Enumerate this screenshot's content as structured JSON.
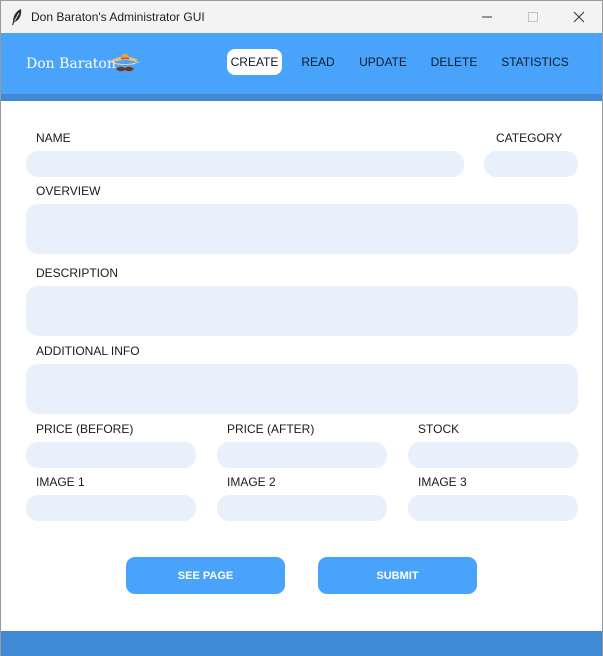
{
  "window": {
    "title": "Don Baraton's Administrator GUI"
  },
  "header": {
    "brand": "Don Baraton",
    "nav": [
      {
        "label": "CREATE",
        "active": true
      },
      {
        "label": "READ"
      },
      {
        "label": "UPDATE"
      },
      {
        "label": "DELETE"
      },
      {
        "label": "STATISTICS"
      }
    ]
  },
  "form": {
    "name_label": "NAME",
    "category_label": "CATEGORY",
    "overview_label": "OVERVIEW",
    "description_label": "DESCRIPTION",
    "additional_info_label": "ADDITIONAL INFO",
    "price_before_label": "PRICE (BEFORE)",
    "price_after_label": "PRICE (AFTER)",
    "stock_label": "STOCK",
    "image1_label": "IMAGE 1",
    "image2_label": "IMAGE 2",
    "image3_label": "IMAGE 3"
  },
  "actions": {
    "see_page_label": "SEE PAGE",
    "submit_label": "SUBMIT"
  },
  "colors": {
    "header": "#4aa3fb",
    "header_strip": "#3f89d6",
    "field_bg": "#e8f0fb",
    "button": "#4aa3fb"
  }
}
